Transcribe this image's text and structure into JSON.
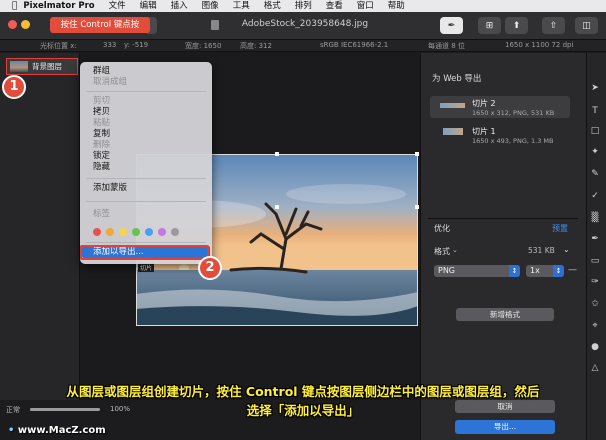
{
  "menubar": {
    "apple": "",
    "app_name": "Pixelmator Pro",
    "items": [
      "文件",
      "编辑",
      "插入",
      "图像",
      "工具",
      "格式",
      "排列",
      "查看",
      "窗口",
      "帮助"
    ]
  },
  "window": {
    "title": "AdobeStock_203958648.jpg"
  },
  "infobar": {
    "cursor_label": "光标位置 x:",
    "cursor_x": "333",
    "cursor_y": "y: -519",
    "width": "宽度: 1650",
    "height": "高度: 312",
    "colorspace": "sRGB IEC61966-2.1",
    "depth": "每通道 8 位",
    "size": "1650 x 1100 72 dpi"
  },
  "layers": {
    "items": [
      {
        "label": "背景图层"
      }
    ],
    "footer_mode": "正常",
    "opacity": "100%",
    "opacity_level": 1.0
  },
  "context_menu": {
    "group": "群组",
    "ungroup": "取消成组",
    "cut": "剪切",
    "copy": "拷贝",
    "paste": "粘贴",
    "duplicate": "复制",
    "delete": "删除",
    "lock": "锁定",
    "hide": "隐藏",
    "add_mask": "添加蒙版",
    "tags": "标签",
    "add_to_export": "添加以导出...",
    "tag_colors": [
      "#e5534b",
      "#f0a83a",
      "#f5d547",
      "#66c34f",
      "#4aa0f2",
      "#c377e0",
      "#9a9a9e"
    ]
  },
  "canvas": {
    "handle_label": "切片"
  },
  "export_panel": {
    "title": "为 Web 导出",
    "slices": [
      {
        "name": "切片 2",
        "meta": "1650 x 312, PNG, 531 KB"
      },
      {
        "name": "切片 1",
        "meta": "1650 x 493, PNG, 1.3 MB"
      }
    ],
    "optimize_label": "优化",
    "preset_label": "预置",
    "format_label": "格式",
    "file_size": "531 KB",
    "format_value": "PNG",
    "scale_value": "1x",
    "add_format_button": "新增格式",
    "cancel_button": "取消",
    "export_button": "导出..."
  },
  "callouts": {
    "tip": "按住 Control 键点按",
    "step1": "1",
    "step2": "2"
  },
  "caption": {
    "line1": "从图层或图层组创建切片，按住 Control 键点按图层侧边栏中的图层或图层组，然后",
    "line2": "选择「添加以导出」"
  },
  "watermark": "www.MacZ.com",
  "colors": {
    "accent": "#2c74d6",
    "callout": "#e24d3b",
    "caption": "#ffee3a"
  }
}
